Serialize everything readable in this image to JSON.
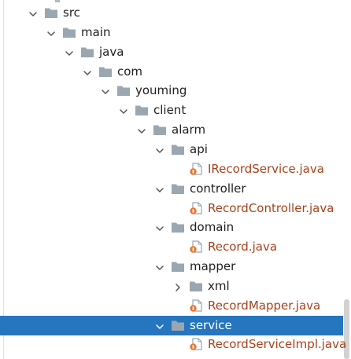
{
  "tree": {
    "rows": [
      {
        "label": "src",
        "kind": "folder",
        "chevron": "expanded",
        "depth": 1,
        "selected": false
      },
      {
        "label": "main",
        "kind": "folder",
        "chevron": "expanded",
        "depth": 2,
        "selected": false
      },
      {
        "label": "java",
        "kind": "folder",
        "chevron": "expanded",
        "depth": 3,
        "selected": false
      },
      {
        "label": "com",
        "kind": "folder",
        "chevron": "expanded",
        "depth": 4,
        "selected": false
      },
      {
        "label": "youming",
        "kind": "folder",
        "chevron": "expanded",
        "depth": 5,
        "selected": false
      },
      {
        "label": "client",
        "kind": "folder",
        "chevron": "expanded",
        "depth": 6,
        "selected": false
      },
      {
        "label": "alarm",
        "kind": "folder",
        "chevron": "expanded",
        "depth": 7,
        "selected": false
      },
      {
        "label": "api",
        "kind": "folder",
        "chevron": "expanded",
        "depth": 8,
        "selected": false
      },
      {
        "label": "IRecordService.java",
        "kind": "java",
        "chevron": "none",
        "depth": 9,
        "selected": false
      },
      {
        "label": "controller",
        "kind": "folder",
        "chevron": "expanded",
        "depth": 8,
        "selected": false
      },
      {
        "label": "RecordController.java",
        "kind": "java",
        "chevron": "none",
        "depth": 9,
        "selected": false
      },
      {
        "label": "domain",
        "kind": "folder",
        "chevron": "expanded",
        "depth": 8,
        "selected": false
      },
      {
        "label": "Record.java",
        "kind": "java",
        "chevron": "none",
        "depth": 9,
        "selected": false
      },
      {
        "label": "mapper",
        "kind": "folder",
        "chevron": "expanded",
        "depth": 8,
        "selected": false
      },
      {
        "label": "xml",
        "kind": "folder",
        "chevron": "collapsed",
        "depth": 9,
        "selected": false
      },
      {
        "label": "RecordMapper.java",
        "kind": "java",
        "chevron": "none",
        "depth": 9,
        "selected": false
      },
      {
        "label": "service",
        "kind": "folder",
        "chevron": "expanded",
        "depth": 8,
        "selected": true
      },
      {
        "label": "RecordServiceImpl.java",
        "kind": "java",
        "chevron": "none",
        "depth": 9,
        "selected": false
      }
    ]
  },
  "colors": {
    "folder": "#9aa7b0",
    "java_text": "#a8421c",
    "java_file_icon": "#9aa7b0",
    "java_badge": "#e8762d",
    "selection": "#2675bf"
  },
  "icons": {
    "expanded": "chevron-down-icon",
    "collapsed": "chevron-right-icon",
    "folder": "folder-icon",
    "java": "java-class-file-icon"
  }
}
